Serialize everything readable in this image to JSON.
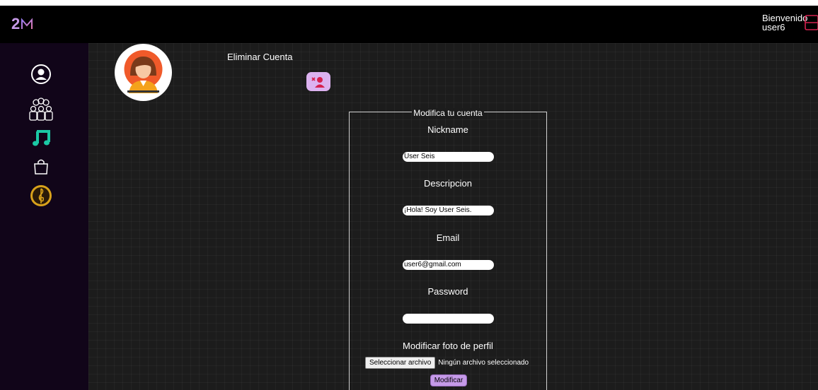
{
  "header": {
    "logo_text": "2",
    "welcome_line1": "Bienvenido",
    "welcome_line2": "user6",
    "logout_icon": "logout-icon"
  },
  "sidebar": {
    "items": [
      {
        "icon": "user-circle-icon"
      },
      {
        "icon": "group-icon"
      },
      {
        "icon": "music-note-icon"
      },
      {
        "icon": "shopping-bag-icon"
      },
      {
        "icon": "treble-clef-medal-icon"
      }
    ]
  },
  "profile": {
    "avatar_icon": "woman-avatar-icon",
    "delete_title": "Eliminar Cuenta",
    "delete_icon": "remove-user-icon"
  },
  "form": {
    "legend": "Modifica tu cuenta",
    "nickname_label": "Nickname",
    "nickname_value": "User Seis",
    "description_label": "Descripcion",
    "description_value": "¡Hola! Soy User Seis.",
    "email_label": "Email",
    "email_value": "user6@gmail.com",
    "password_label": "Password",
    "password_value": "",
    "photo_label": "Modificar foto de perfil",
    "file_button": "Seleccionar archivo",
    "file_status": "Ningún archivo seleccionado",
    "submit_label": "Modificar"
  },
  "colors": {
    "accent": "#c59ae8",
    "sidebar_bg": "#110519",
    "topbar_bg": "#000000",
    "music_icon": "#1bc9a5",
    "medal_icon": "#d9a21b",
    "danger": "#d6204f"
  }
}
